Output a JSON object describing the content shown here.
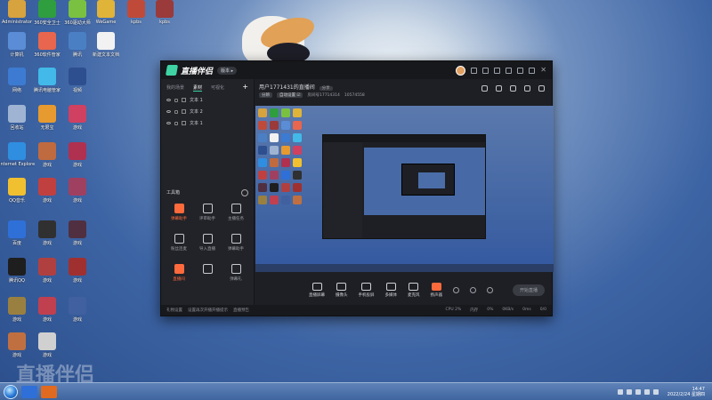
{
  "window": {
    "app_name": "直播伴侣",
    "version_label": "版本 ▸",
    "tabs": [
      "我的场景",
      "素材",
      "可视化"
    ],
    "active_tab": 1,
    "scene_items": [
      "文本 1",
      "文本 2",
      "文本 1"
    ],
    "tools_title": "工具箱",
    "tools": [
      {
        "label": "弹幕助手",
        "highlight": true
      },
      {
        "label": "评审助手",
        "highlight": false
      },
      {
        "label": "主播任务",
        "highlight": false
      },
      {
        "label": "粉丝连麦",
        "highlight": false
      },
      {
        "label": "导入直播",
        "highlight": false
      },
      {
        "label": "弹幕助手",
        "highlight": false
      },
      {
        "label": "直播间",
        "highlight": true
      },
      {
        "label": "",
        "highlight": false
      },
      {
        "label": "弹幕礼",
        "highlight": false
      }
    ],
    "room_title": "用户1771431的直播间",
    "room_tag": "分享",
    "room_meta_chip1": "分辨",
    "room_meta_chip2": "自动设置 ☑",
    "room_id": "房间号17714314",
    "room_stat": "10574558",
    "controls": [
      {
        "label": "直播屏幕",
        "highlight": false
      },
      {
        "label": "摄像头",
        "highlight": false
      },
      {
        "label": "手机投屏",
        "highlight": false
      },
      {
        "label": "多媒体",
        "highlight": false
      },
      {
        "label": "麦克风",
        "highlight": false
      },
      {
        "label": "扬声器",
        "highlight": true
      }
    ],
    "start_button": "开始直播",
    "bottom_left_1": "礼物设置",
    "bottom_left_2": "设置再次开播开播提示",
    "bottom_left_3": "直播预告",
    "stats": [
      "CPU 2%",
      "内存",
      "0%",
      "0KB/s",
      "0ms",
      "0/0"
    ]
  },
  "desktop_icons": [
    {
      "label": "Administrator",
      "color": "#d6a33e"
    },
    {
      "label": "360安全卫士",
      "color": "#2f9e3e"
    },
    {
      "label": "360驱动大师",
      "color": "#7ac142"
    },
    {
      "label": "WeGame",
      "color": "#e0b339"
    },
    {
      "label": "kpbs",
      "color": "#c04a3a"
    },
    {
      "label": "kpbs",
      "color": "#9a3a3a"
    },
    {
      "label": "计算机",
      "color": "#5b8dd6"
    },
    {
      "label": "360软件管家",
      "color": "#e7664d"
    },
    {
      "label": "腾讯",
      "color": "#4a7fc4"
    },
    {
      "label": "新建文本文档",
      "color": "#f2f2f2"
    },
    {
      "label": "网络",
      "color": "#3c7bd1"
    },
    {
      "label": "腾讯电脑管家",
      "color": "#42b9e8"
    },
    {
      "label": "视频",
      "color": "#2e4f8f"
    },
    {
      "label": "回收站",
      "color": "#9fb4d2"
    },
    {
      "label": "无限宝",
      "color": "#e79a2f"
    },
    {
      "label": "游戏",
      "color": "#d04060"
    },
    {
      "label": "Internet Explorer",
      "color": "#2f8ee0"
    },
    {
      "label": "游戏",
      "color": "#c06a40"
    },
    {
      "label": "游戏",
      "color": "#b03050"
    },
    {
      "label": "QQ音乐",
      "color": "#f0c030"
    },
    {
      "label": "游戏",
      "color": "#c04040"
    },
    {
      "label": "游戏",
      "color": "#a04060"
    },
    {
      "label": "百度",
      "color": "#2f70d8"
    },
    {
      "label": "游戏",
      "color": "#303030"
    },
    {
      "label": "游戏",
      "color": "#503040"
    },
    {
      "label": "腾讯QQ",
      "color": "#1e1e1e"
    },
    {
      "label": "游戏",
      "color": "#b04040"
    },
    {
      "label": "游戏",
      "color": "#a03030"
    },
    {
      "label": "游戏",
      "color": "#9a8040"
    },
    {
      "label": "游戏",
      "color": "#c04050"
    },
    {
      "label": "游戏",
      "color": "#4060a0"
    },
    {
      "label": "游戏",
      "color": "#c07040"
    },
    {
      "label": "游戏",
      "color": "#d0d0d0"
    }
  ],
  "taskbar": {
    "time": "14:47",
    "date": "2022/2/24 星期四",
    "watermark": "直播伴侣"
  },
  "colors": {
    "accent": "#3fd3a4",
    "highlight": "#ff6a3d"
  }
}
